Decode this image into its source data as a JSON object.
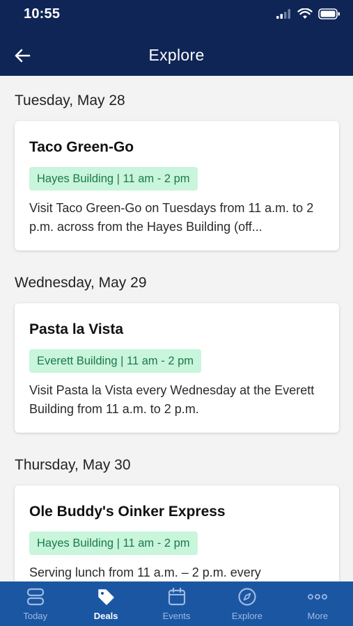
{
  "status": {
    "time": "10:55"
  },
  "header": {
    "title": "Explore"
  },
  "days": [
    {
      "date": "Tuesday, May 28",
      "card": {
        "title": "Taco Green-Go",
        "tag": "Hayes Building | 11 am - 2 pm",
        "description": "Visit Taco Green-Go on Tuesdays from 11 a.m. to 2 p.m. across from the Hayes Building (off..."
      }
    },
    {
      "date": "Wednesday, May 29",
      "card": {
        "title": "Pasta la Vista",
        "tag": "Everett Building | 11 am - 2 pm",
        "description": "Visit Pasta la Vista every Wednesday at the Everett Building from 11 a.m. to 2 p.m."
      }
    },
    {
      "date": "Thursday, May 30",
      "card": {
        "title": "Ole Buddy's Oinker Express",
        "tag": "Hayes Building | 11 am - 2 pm",
        "description": "Serving lunch from 11 a.m. – 2 p.m. every"
      }
    }
  ],
  "tabs": [
    {
      "label": "Today",
      "icon": "stack-icon",
      "active": false
    },
    {
      "label": "Deals",
      "icon": "tag-icon",
      "active": true
    },
    {
      "label": "Events",
      "icon": "calendar-icon",
      "active": false
    },
    {
      "label": "Explore",
      "icon": "compass-icon",
      "active": false
    },
    {
      "label": "More",
      "icon": "more-dots-icon",
      "active": false
    }
  ],
  "colors": {
    "header_bg": "#0f2556",
    "tab_bar_bg": "#1b56a3",
    "tag_bg": "#c9f5dc",
    "tag_text": "#1a7a47"
  }
}
